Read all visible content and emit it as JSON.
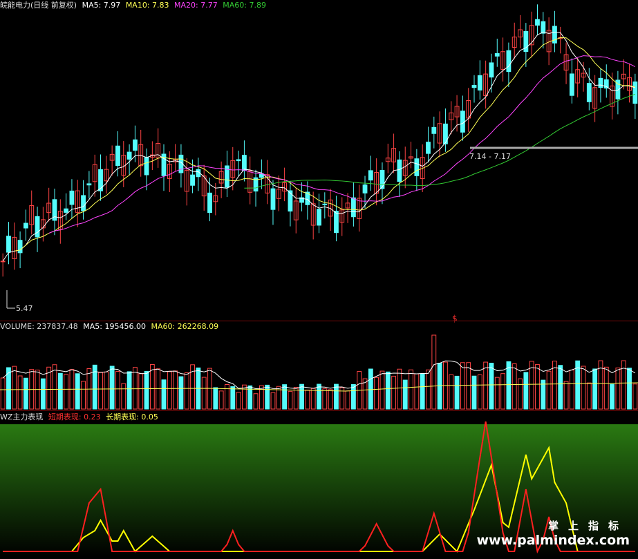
{
  "main_header": {
    "title": "皖能电力(日线 前复权)",
    "ma5": "MA5: 7.97",
    "ma10": "MA10: 7.83",
    "ma20": "MA20: 7.77",
    "ma60": "MA60: 7.89"
  },
  "volume_header": {
    "label": "VOLUME: 237837.48",
    "ma5": "MA5: 195456.00",
    "ma60": "MA60: 262268.09"
  },
  "indicator_header": {
    "label": "WZ主力表现",
    "short": "短期表现: 0.23",
    "long": "长期表现: 0.05"
  },
  "annotations": {
    "low_label": "5.47",
    "range_label": "7.14 - 7.17",
    "marker": "$"
  },
  "watermark": {
    "line1": "掌上指标",
    "line2": "www.palmindex.com"
  },
  "colors": {
    "up": "#ff4444",
    "down": "#54fcfc",
    "ma5": "#ffffff",
    "ma10": "#ffff55",
    "ma20": "#ff44ff",
    "ma60": "#33cc33",
    "short_line": "#ff2020",
    "long_line": "#ffff00"
  }
}
